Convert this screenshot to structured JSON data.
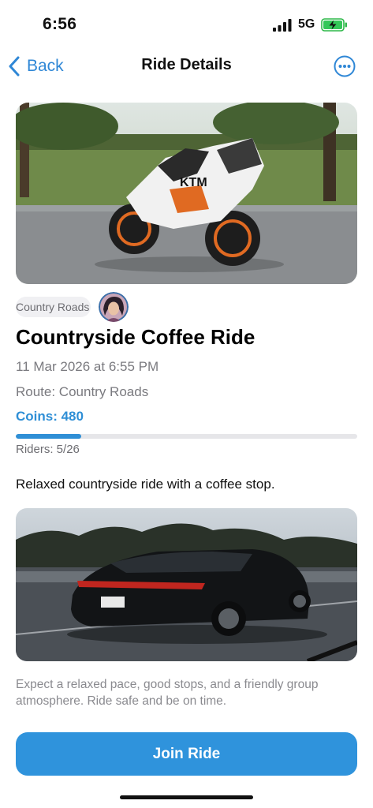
{
  "status_bar": {
    "time": "6:56",
    "network": "5G"
  },
  "nav": {
    "back_label": "Back",
    "title": "Ride Details",
    "more_icon": "ellipsis-circle-icon"
  },
  "ride": {
    "tag": "Country Roads",
    "title": "Countryside Coffee Ride",
    "datetime": "11 Mar 2026 at 6:55 PM",
    "route": "Route: Country Roads",
    "coins": "Coins: 480",
    "riders_text": "Riders: 5/26",
    "riders_fraction": 0.192,
    "description": "Relaxed countryside ride with a coffee stop.",
    "details": "Expect a relaxed pace, good stops, and a friendly group atmosphere. Ride safe and be on time."
  },
  "actions": {
    "join_label": "Join Ride"
  },
  "colors": {
    "accent": "#2f8fd6",
    "button": "#2f93dc",
    "muted_text": "#7a7a7f"
  }
}
